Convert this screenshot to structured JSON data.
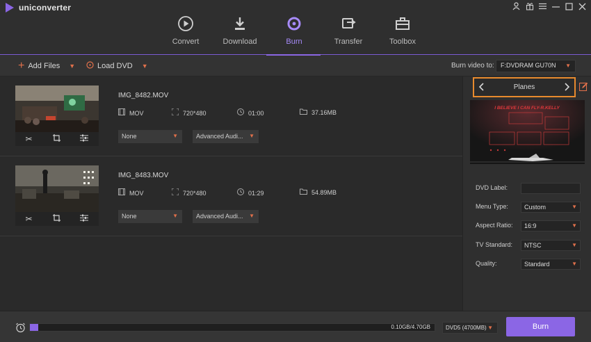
{
  "app": {
    "name": "uniconverter"
  },
  "window_controls": [
    "user-icon",
    "gift-icon",
    "menu-icon",
    "minimize-icon",
    "maximize-icon",
    "close-icon"
  ],
  "nav": {
    "tabs": [
      {
        "label": "Convert",
        "icon": "convert-icon",
        "active": false
      },
      {
        "label": "Download",
        "icon": "download-icon",
        "active": false
      },
      {
        "label": "Burn",
        "icon": "burn-icon",
        "active": true
      },
      {
        "label": "Transfer",
        "icon": "transfer-icon",
        "active": false
      },
      {
        "label": "Toolbox",
        "icon": "toolbox-icon",
        "active": false
      }
    ]
  },
  "toolbar": {
    "add_files": "Add Files",
    "load_dvd": "Load DVD",
    "burn_to_label": "Burn video to:",
    "burn_to_value": "F:DVDRAM GU70N"
  },
  "files": [
    {
      "name": "IMG_8482.MOV",
      "format": "MOV",
      "resolution": "720*480",
      "duration": "01:00",
      "size": "37.16MB",
      "subtitle": "None",
      "audio": "Advanced Audi..."
    },
    {
      "name": "IMG_8483.MOV",
      "format": "MOV",
      "resolution": "720*480",
      "duration": "01:29",
      "size": "54.89MB",
      "subtitle": "None",
      "audio": "Advanced Audi..."
    }
  ],
  "template": {
    "name": "Planes",
    "preview_title": "I BELIEVE I CAN FLY-R.KELLY"
  },
  "settings": {
    "dvd_label": {
      "label": "DVD Label:",
      "value": ""
    },
    "menu_type": {
      "label": "Menu Type:",
      "value": "Custom"
    },
    "aspect_ratio": {
      "label": "Aspect Ratio:",
      "value": "16:9"
    },
    "tv_standard": {
      "label": "TV Standard:",
      "value": "NTSC"
    },
    "quality": {
      "label": "Quality:",
      "value": "Standard"
    }
  },
  "bottom": {
    "usage_text": "0.10GB/4.70GB",
    "usage_fraction": 0.02,
    "disc_type": "DVD5 (4700MB)",
    "burn_label": "Burn"
  },
  "colors": {
    "accent": "#8b66e5",
    "highlight": "#e88a2d",
    "caret": "#e0704b"
  }
}
